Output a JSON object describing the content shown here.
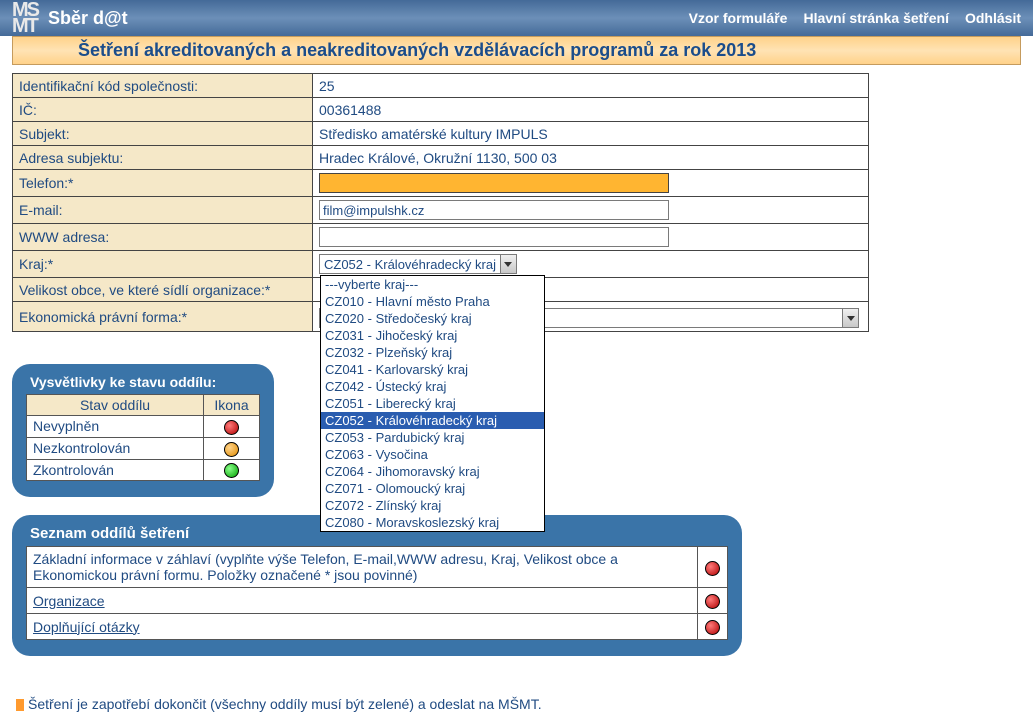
{
  "topbar": {
    "appName": "Sběr d@t",
    "logo1": "MS",
    "logo2": "MT",
    "links": {
      "form": "Vzor formuláře",
      "main": "Hlavní stránka šetření",
      "logout": "Odhlásit"
    }
  },
  "heading": "Šetření akreditovaných a neakreditovaných vzdělávacích programů za rok 2013",
  "info": {
    "id_label": "Identifikační kód společnosti:",
    "id_value": "25",
    "ic_label": "IČ:",
    "ic_value": "00361488",
    "subject_label": "Subjekt:",
    "subject_value": "Středisko amatérské kultury IMPULS",
    "address_label": "Adresa subjektu:",
    "address_value": "Hradec Králové, Okružní 1130, 500 03",
    "phone_label": "Telefon:*",
    "phone_value": "",
    "email_label": "E-mail:",
    "email_value": "film@impulshk.cz",
    "www_label": "WWW adresa:",
    "www_value": "",
    "region_label": "Kraj:*",
    "region_selected": "CZ052 - Královéhradecký kraj",
    "size_label": "Velikost obce, ve které sídlí organizace:*",
    "legal_label": "Ekonomická právní forma:*"
  },
  "region_options": [
    "---vyberte kraj---",
    "CZ010 - Hlavní město Praha",
    "CZ020 - Středočeský kraj",
    "CZ031 - Jihočeský kraj",
    "CZ032 - Plzeňský kraj",
    "CZ041 - Karlovarský kraj",
    "CZ042 - Ústecký kraj",
    "CZ051 - Liberecký kraj",
    "CZ052 - Královéhradecký kraj",
    "CZ053 - Pardubický kraj",
    "CZ063 - Vysočina",
    "CZ064 - Jihomoravský kraj",
    "CZ071 - Olomoucký kraj",
    "CZ072 - Zlínský kraj",
    "CZ080 - Moravskoslezský kraj"
  ],
  "region_highlight_index": 8,
  "legend": {
    "title": "Vysvětlivky ke stavu oddílu:",
    "col1": "Stav oddílu",
    "col2": "Ikona",
    "rows": [
      {
        "label": "Nevyplněn",
        "color": "red"
      },
      {
        "label": "Nezkontrolován",
        "color": "orange"
      },
      {
        "label": "Zkontrolován",
        "color": "green"
      }
    ]
  },
  "sections": {
    "title": "Seznam oddílů šetření",
    "rows": [
      {
        "text": "Základní informace v záhlaví (vyplňte výše Telefon, E-mail,WWW adresu, Kraj, Velikost obce a Ekonomickou právní formu. Položky označené * jsou povinné)",
        "link": false,
        "status": "red"
      },
      {
        "text": "Organizace",
        "link": true,
        "status": "red"
      },
      {
        "text": "Doplňující otázky",
        "link": true,
        "status": "red"
      }
    ]
  },
  "footnote": "Šetření je zapotřebí dokončit (všechny oddíly musí být zelené) a odeslat na MŠMT."
}
